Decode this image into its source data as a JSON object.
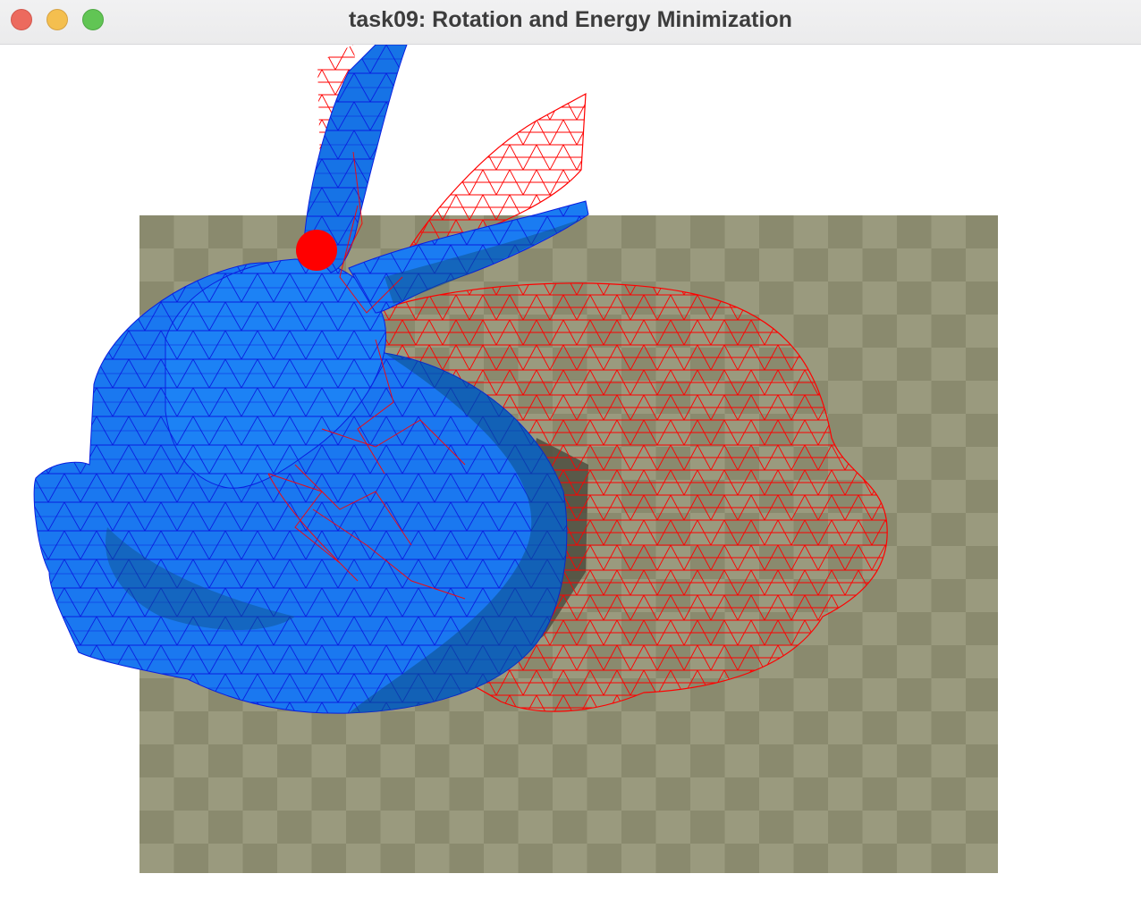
{
  "window": {
    "title": "task09: Rotation and Energy Minimization",
    "buttons": [
      "close",
      "minimize",
      "maximize"
    ]
  },
  "scene": {
    "floor": {
      "checker_light": "#9a9a7e",
      "checker_dark": "#8a8a6e"
    },
    "deformed_mesh": {
      "fill": "#1a6ff0",
      "edges": "#0a1ee0",
      "shadow": "#4d4d40"
    },
    "rest_wireframe": {
      "stroke": "#ff0000"
    },
    "handle_point": {
      "color": "#ff0000"
    }
  }
}
